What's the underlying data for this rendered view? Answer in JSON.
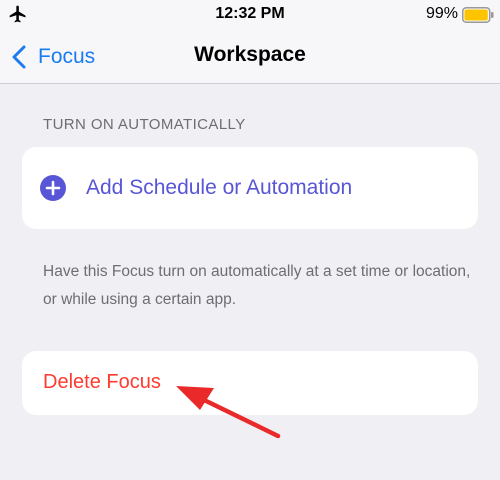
{
  "status_bar": {
    "time": "12:32 PM",
    "battery_percent": "99%",
    "battery_level": 0.99,
    "airplane_icon": "airplane-icon",
    "battery_color": "#ffc400"
  },
  "nav": {
    "back_label": "Focus",
    "title": "Workspace",
    "accent_color": "#1a7cf0"
  },
  "section": {
    "header": "TURN ON AUTOMATICALLY",
    "add_label": "Add Schedule or Automation",
    "add_icon": "plus-circle-icon",
    "footer": "Have this Focus turn on automatically at a set time or location, or while using a certain app."
  },
  "delete": {
    "label": "Delete Focus",
    "color": "#ff3b30"
  },
  "annotation": {
    "icon": "red-arrow-icon",
    "color": "#ea2a2a"
  }
}
